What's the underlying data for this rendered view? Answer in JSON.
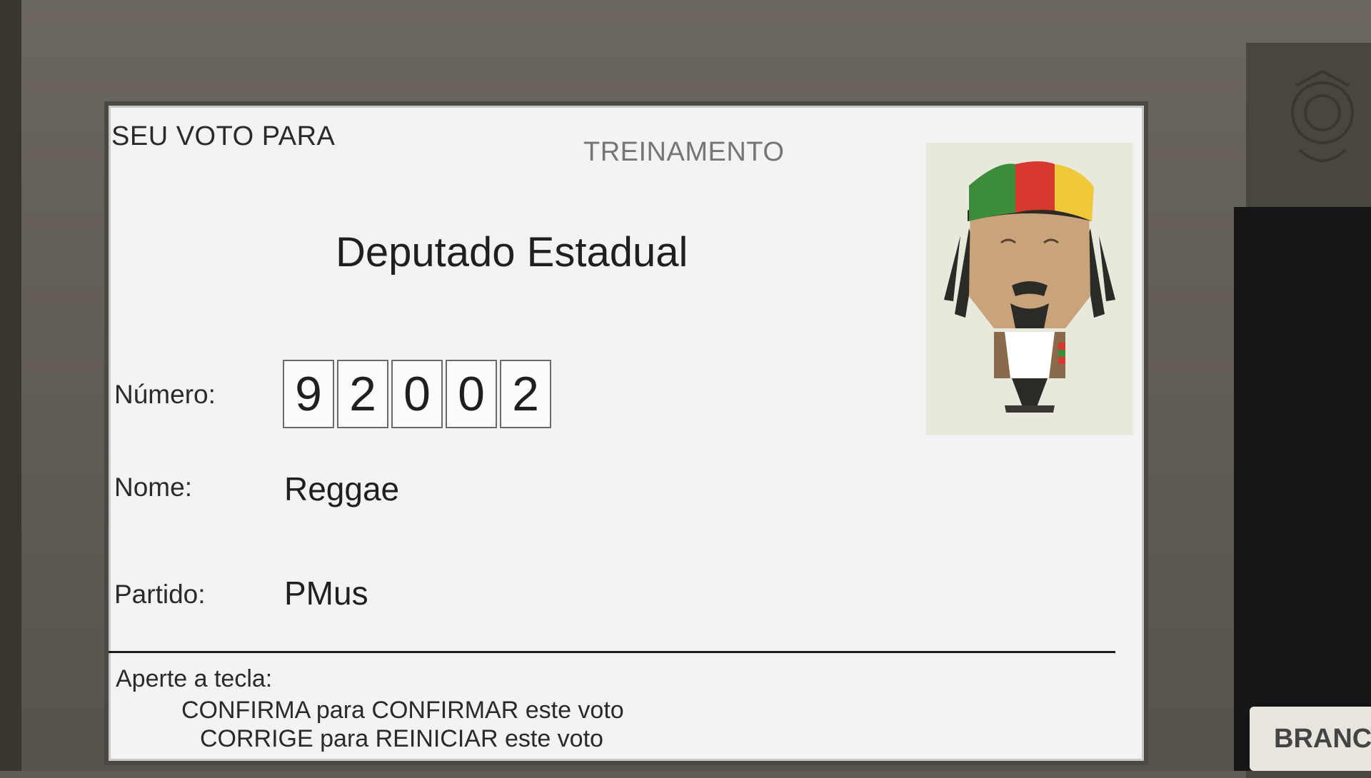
{
  "screen": {
    "header_left": "SEU VOTO PARA",
    "header_center": "TREINAMENTO",
    "office_title": "Deputado Estadual",
    "fields": {
      "number_label": "Número:",
      "name_label": "Nome:",
      "party_label": "Partido:"
    },
    "candidate": {
      "digits": [
        "9",
        "2",
        "0",
        "0",
        "2"
      ],
      "name": "Reggae",
      "party": "PMus",
      "photo_icon": "candidate-cartoon-icon"
    },
    "instructions": {
      "title": "Aperte a tecla:",
      "confirm_line": "CONFIRMA para CONFIRMAR este voto",
      "correct_line": "CORRIGE para REINICIAR este voto"
    }
  },
  "device": {
    "branco_key_label": "BRANCO",
    "emblem_icon": "coat-of-arms-icon"
  },
  "colors": {
    "screen_bg": "#f1f3f4",
    "bezel": "#625d55",
    "cap_green": "#3c8c3a",
    "cap_red": "#d8392f",
    "cap_yellow": "#f0c93a"
  }
}
